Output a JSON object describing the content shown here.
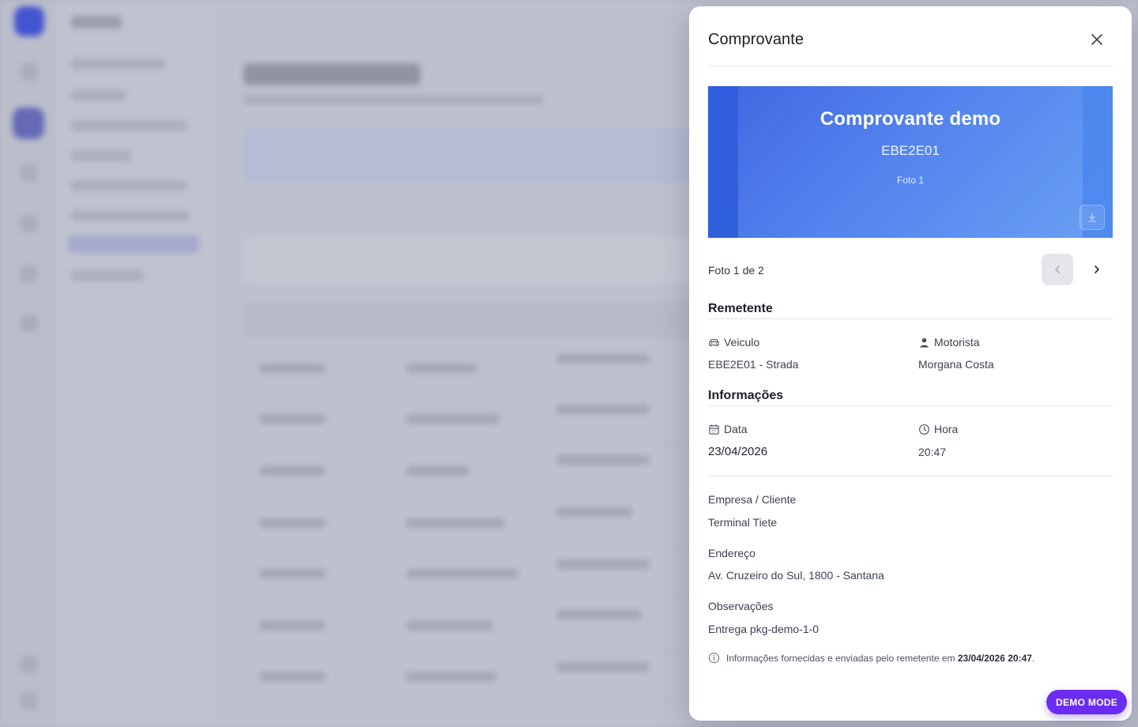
{
  "drawer": {
    "title": "Comprovante",
    "photo": {
      "title": "Comprovante demo",
      "code": "EBE2E01",
      "caption": "Foto 1"
    },
    "pager": {
      "label": "Foto 1 de 2"
    },
    "sections": {
      "sender": "Remetente",
      "info": "Informações"
    },
    "vehicle": {
      "label": "Veiculo",
      "value": "EBE2E01 - Strada"
    },
    "driver": {
      "label": "Motorista",
      "value": "Morgana Costa"
    },
    "date": {
      "label": "Data",
      "value": "23/04/2026"
    },
    "time": {
      "label": "Hora",
      "value": "20:47"
    },
    "company": {
      "label": "Empresa / Cliente",
      "value": "Terminal Tiete"
    },
    "address": {
      "label": "Endereço",
      "value": "Av. Cruzeiro do Sul, 1800 - Santana"
    },
    "notes": {
      "label": "Observações",
      "value": "Entrega pkg-demo-1-0"
    },
    "footer_note": {
      "text": "Informações fornecidas e enviadas pelo remetente em",
      "datetime": "23/04/2026 20:47",
      "suffix": "."
    }
  },
  "badge": {
    "label": "DEMO MODE"
  },
  "icons": {
    "close": "close-icon",
    "download": "download-icon",
    "prev": "chevron-left-icon",
    "next": "chevron-right-icon",
    "vehicle": "car-icon",
    "driver": "user-icon",
    "date": "calendar-icon",
    "time": "clock-icon",
    "info": "info-icon"
  },
  "colors": {
    "accent": "#6a2cf0",
    "photo": "#5383ee"
  }
}
